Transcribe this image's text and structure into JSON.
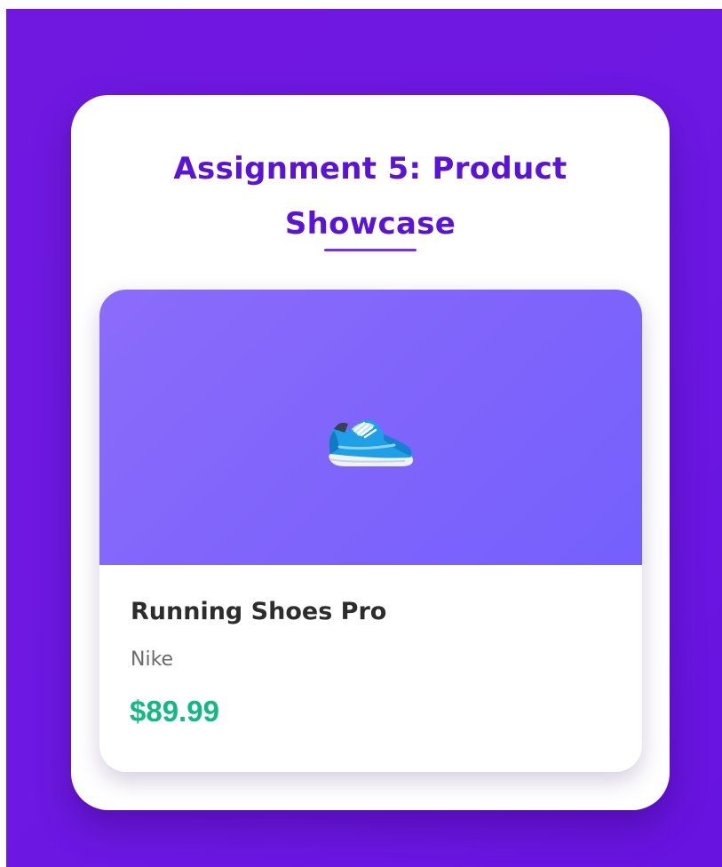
{
  "page": {
    "title": "Assignment 5: Product Showcase"
  },
  "product": {
    "icon": "running-shoe-icon",
    "name": "Running Shoes Pro",
    "brand": "Nike",
    "price": "$89.99"
  },
  "colors": {
    "background": "#6c16e0",
    "title": "#5b13d6",
    "accent": "#7a2df0",
    "image_gradient_start": "#8b6cfb",
    "image_gradient_end": "#7560fd",
    "product_name": "#2d2d2d",
    "brand": "#6b6b6b",
    "price": "#14b885"
  }
}
